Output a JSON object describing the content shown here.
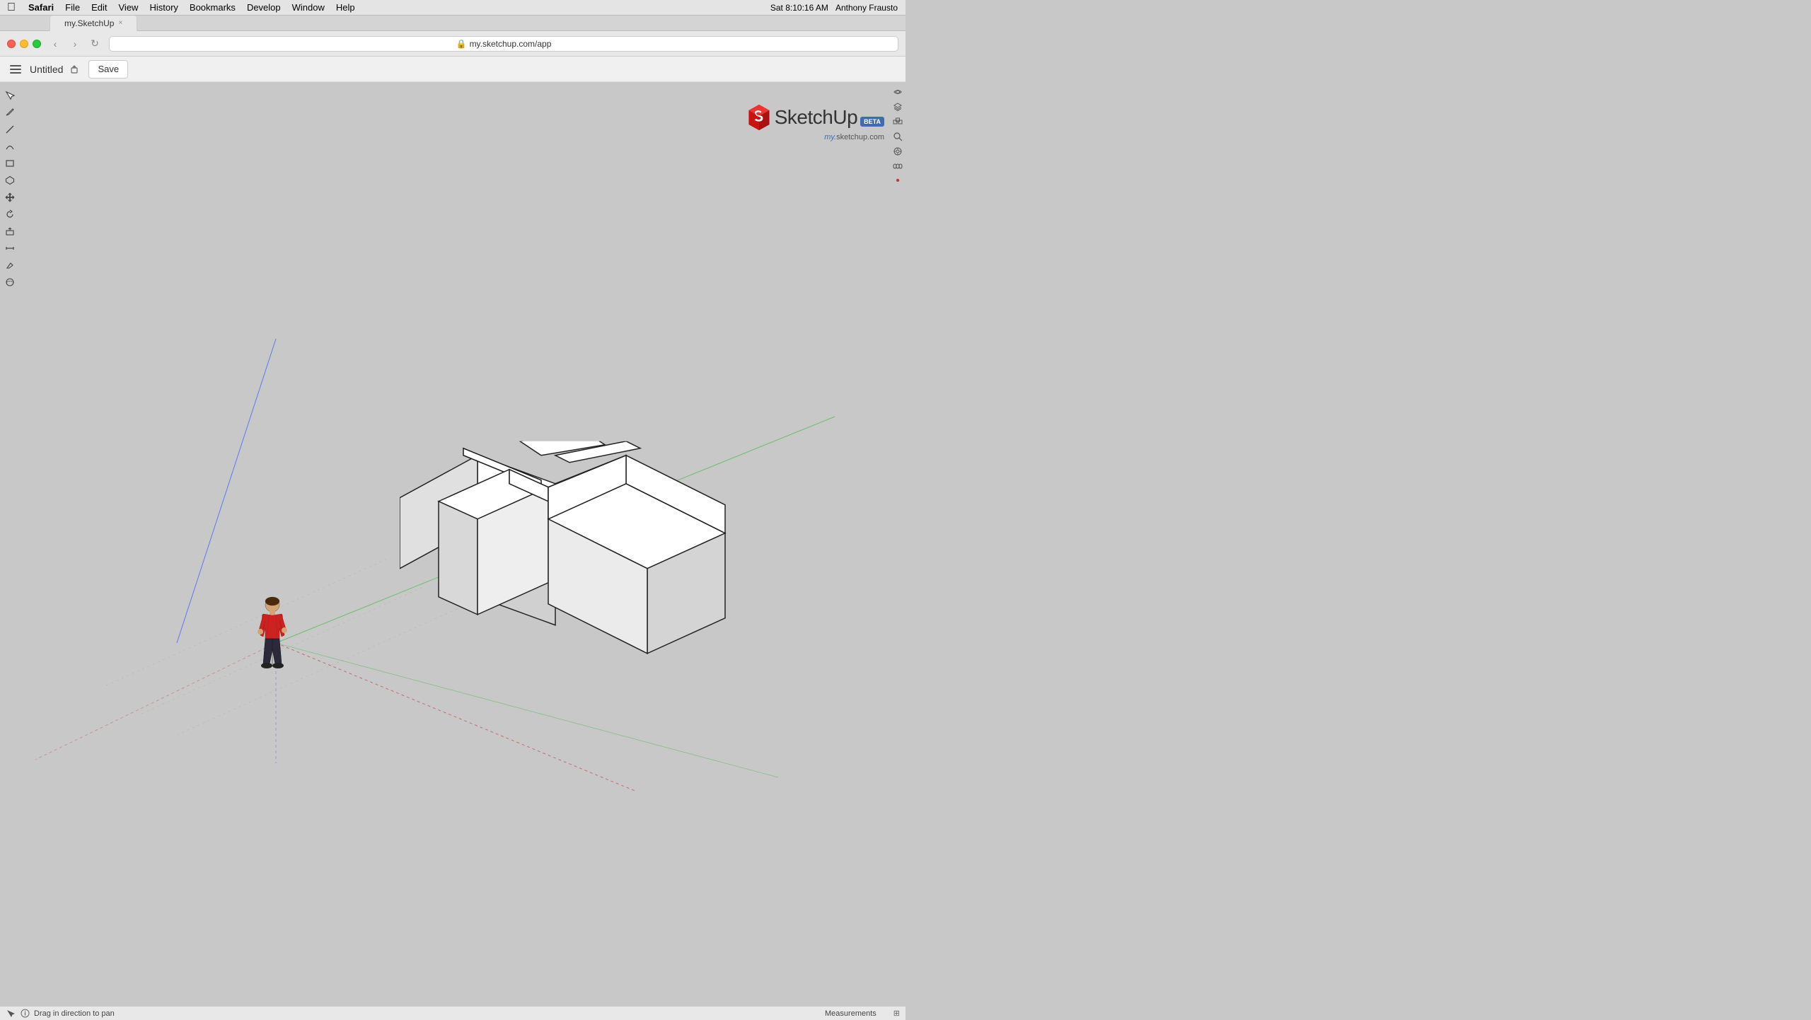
{
  "menubar": {
    "apple": "⌘",
    "appName": "Safari",
    "items": [
      "File",
      "Edit",
      "View",
      "History",
      "Bookmarks",
      "Develop",
      "Window",
      "Help"
    ],
    "right": {
      "time": "Sat 8:10:16 AM",
      "user": "Anthony Frausto"
    }
  },
  "browser": {
    "address": "my.sketchup.com/app",
    "tabLabel": "my.SketchUp",
    "tabClose": "×"
  },
  "toolbar": {
    "menu_label": "≡",
    "file_title": "Untitled",
    "save_label": "Save"
  },
  "logo": {
    "title": "SketchUp",
    "beta": "BETA",
    "subtitle": "my.sketchup.com"
  },
  "tools": {
    "left": [
      {
        "name": "select",
        "icon": "↖"
      },
      {
        "name": "pencil",
        "icon": "✏"
      },
      {
        "name": "line",
        "icon": "/"
      },
      {
        "name": "pen",
        "icon": "✒"
      },
      {
        "name": "rectangle",
        "icon": "▭"
      },
      {
        "name": "polygon",
        "icon": "⬡"
      },
      {
        "name": "move",
        "icon": "✥"
      },
      {
        "name": "rotate",
        "icon": "↻"
      },
      {
        "name": "push-pull",
        "icon": "⊡"
      },
      {
        "name": "measure",
        "icon": "⇔"
      },
      {
        "name": "eraser",
        "icon": "◫"
      },
      {
        "name": "orbit",
        "icon": "⊙"
      }
    ],
    "right": [
      {
        "name": "eye",
        "icon": "👁"
      },
      {
        "name": "layers",
        "icon": "◫"
      },
      {
        "name": "search",
        "icon": "⌕"
      },
      {
        "name": "components",
        "icon": "⊞"
      },
      {
        "name": "materials",
        "icon": "◈"
      },
      {
        "name": "infinity",
        "icon": "∞"
      }
    ]
  },
  "status": {
    "drag_hint": "Drag in direction to pan",
    "measurements_label": "Measurements",
    "info_icon": "ℹ",
    "question_icon": "?"
  },
  "axes": {
    "colors": {
      "blue": "#4466ff",
      "green": "#44bb44",
      "red": "#cc4444"
    }
  }
}
